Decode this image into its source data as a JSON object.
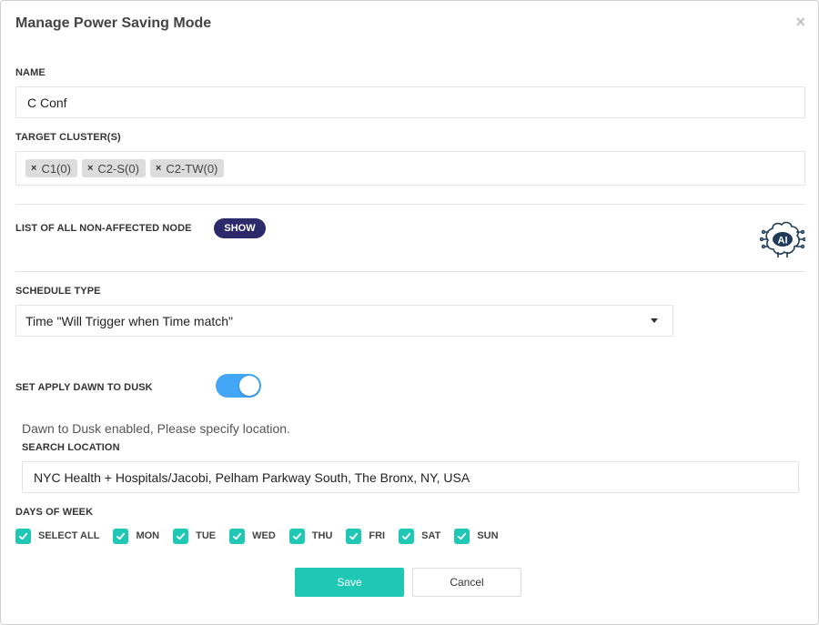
{
  "dialog": {
    "title": "Manage Power Saving Mode",
    "close_label": "×"
  },
  "name": {
    "label": "NAME",
    "value": "C Conf"
  },
  "target_clusters": {
    "label": "TARGET CLUSTER(S)",
    "remove_icon": "×",
    "tags": [
      "C1(0)",
      "C2-S(0)",
      "C2-TW(0)"
    ]
  },
  "non_affected": {
    "label": "LIST OF ALL NON-AFFECTED NODE",
    "show_label": "SHOW",
    "ai_badge_text": "AI"
  },
  "schedule_type": {
    "label": "SCHEDULE TYPE",
    "selected": "Time \"Will Trigger when Time match\""
  },
  "dawn_to_dusk": {
    "label": "SET APPLY DAWN TO DUSK",
    "enabled": true,
    "info": "Dawn to Dusk enabled, Please specify location."
  },
  "search_location": {
    "label": "SEARCH LOCATION",
    "value": "NYC Health + Hospitals/Jacobi, Pelham Parkway South, The Bronx, NY, USA"
  },
  "days_of_week": {
    "label": "DAYS OF WEEK",
    "items": [
      {
        "label": "SELECT ALL",
        "checked": true
      },
      {
        "label": "MON",
        "checked": true
      },
      {
        "label": "TUE",
        "checked": true
      },
      {
        "label": "WED",
        "checked": true
      },
      {
        "label": "THU",
        "checked": true
      },
      {
        "label": "FRI",
        "checked": true
      },
      {
        "label": "SAT",
        "checked": true
      },
      {
        "label": "SUN",
        "checked": true
      }
    ]
  },
  "actions": {
    "save_label": "Save",
    "cancel_label": "Cancel"
  },
  "colors": {
    "accent": "#1ec8b4",
    "toggle": "#42a5f5",
    "show_button": "#2c2a6b"
  },
  "icons": {
    "close": "close-icon",
    "tag_remove": "remove-tag-icon",
    "ai": "ai-brain-icon",
    "select": "caret-down-icon",
    "checkbox": "check-icon"
  }
}
